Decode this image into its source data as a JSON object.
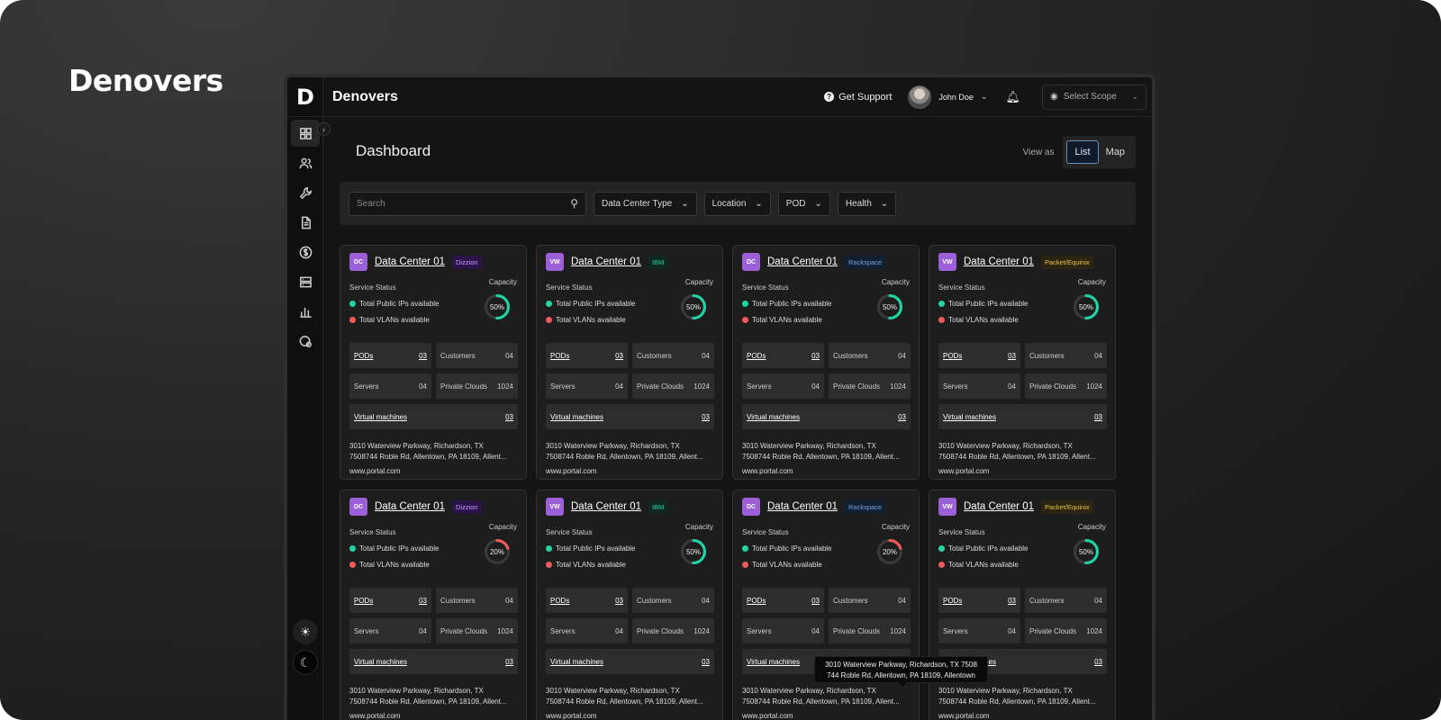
{
  "brand": "Denovers",
  "rail": {
    "logo": "D",
    "icons": [
      "dashboard-icon",
      "users-icon",
      "wrench-icon",
      "document-icon",
      "dollar-icon",
      "server-icon",
      "bar-chart-icon",
      "settings-shield-icon"
    ],
    "active_index": 0,
    "theme_light_icon": "sun-icon",
    "theme_dark_icon": "moon-icon"
  },
  "topbar": {
    "title": "Denovers",
    "support_label": "Get Support",
    "user_name": "John Doe",
    "scope_placeholder": "Select Scope"
  },
  "dashboard": {
    "title": "Dashboard",
    "view_as_label": "View as",
    "view_options": [
      "List",
      "Map"
    ],
    "active_view": "List"
  },
  "filters": {
    "search_placeholder": "Search",
    "dropdowns": [
      "Data Center Type",
      "Location",
      "POD",
      "Health"
    ]
  },
  "card_labels": {
    "service_status": "Service Status",
    "capacity": "Capacity",
    "public_ips": "Total Public IPs available",
    "vlans": "Total VLANs available",
    "pods": "PODs",
    "customers": "Customers",
    "servers": "Servers",
    "private_clouds": "Private Clouds",
    "virtual_machines": "Virtual machines"
  },
  "colors": {
    "green": "#22d3a6",
    "red": "#ef5b5b",
    "badge_purple": "#9b5fd8"
  },
  "cards": [
    {
      "badge": "DC",
      "title": "Data Center 01",
      "provider": "Dizzion",
      "provider_bg": "#2a1448",
      "provider_fg": "#c79bff",
      "capacity": 50,
      "capacity_text": "50%",
      "pods": "03",
      "customers": "04",
      "servers": "04",
      "private_clouds": "1024",
      "virtual_machines": "03",
      "address_1": "3010 Waterview Parkway, Richardson, TX",
      "address_2": "7508744 Roble Rd, Allentown, PA 18109, Allent...",
      "url": "www.portal.com"
    },
    {
      "badge": "VW",
      "title": "Data Center 01",
      "provider": "IBM",
      "provider_bg": "#10281f",
      "provider_fg": "#22d3a6",
      "capacity": 50,
      "capacity_text": "50%",
      "pods": "03",
      "customers": "04",
      "servers": "04",
      "private_clouds": "1024",
      "virtual_machines": "03",
      "address_1": "3010 Waterview Parkway, Richardson, TX",
      "address_2": "7508744 Roble Rd, Allentown, PA 18109, Allent...",
      "url": "www.portal.com"
    },
    {
      "badge": "DC",
      "title": "Data Center 01",
      "provider": "Rackspace",
      "provider_bg": "#122033",
      "provider_fg": "#7aa3d9",
      "capacity": 50,
      "capacity_text": "50%",
      "pods": "03",
      "customers": "04",
      "servers": "04",
      "private_clouds": "1024",
      "virtual_machines": "03",
      "address_1": "3010 Waterview Parkway, Richardson, TX",
      "address_2": "7508744 Roble Rd, Allentown, PA 18109, Allent...",
      "url": "www.portal.com"
    },
    {
      "badge": "VW",
      "title": "Data Center 01",
      "provider": "Packet/Equinix",
      "provider_bg": "#2a2410",
      "provider_fg": "#e8c64a",
      "capacity": 50,
      "capacity_text": "50%",
      "pods": "03",
      "customers": "04",
      "servers": "04",
      "private_clouds": "1024",
      "virtual_machines": "03",
      "address_1": "3010 Waterview Parkway, Richardson, TX",
      "address_2": "7508744 Roble Rd, Allentown, PA 18109, Allent...",
      "url": "www.portal.com"
    },
    {
      "badge": "DC",
      "title": "Data Center 01",
      "provider": "Dizzion",
      "provider_bg": "#2a1448",
      "provider_fg": "#c79bff",
      "capacity": 20,
      "capacity_text": "20%",
      "pods": "03",
      "customers": "04",
      "servers": "04",
      "private_clouds": "1024",
      "virtual_machines": "03",
      "address_1": "3010 Waterview Parkway, Richardson, TX",
      "address_2": "7508744 Roble Rd, Allentown, PA 18109, Allent...",
      "url": "www.portal.com"
    },
    {
      "badge": "VW",
      "title": "Data Center 01",
      "provider": "IBM",
      "provider_bg": "#10281f",
      "provider_fg": "#22d3a6",
      "capacity": 50,
      "capacity_text": "50%",
      "pods": "03",
      "customers": "04",
      "servers": "04",
      "private_clouds": "1024",
      "virtual_machines": "03",
      "address_1": "3010 Waterview Parkway, Richardson, TX",
      "address_2": "7508744 Roble Rd, Allentown, PA 18109, Allent...",
      "url": "www.portal.com"
    },
    {
      "badge": "DC",
      "title": "Data Center 01",
      "provider": "Rackspace",
      "provider_bg": "#122033",
      "provider_fg": "#7aa3d9",
      "capacity": 20,
      "capacity_text": "20%",
      "pods": "03",
      "customers": "04",
      "servers": "04",
      "private_clouds": "1024",
      "virtual_machines": "03",
      "address_1": "3010 Waterview Parkway, Richardson, TX",
      "address_2": "7508744 Roble Rd, Allentown, PA 18109, Allent...",
      "url": "www.portal.com"
    },
    {
      "badge": "VW",
      "title": "Data Center 01",
      "provider": "Packet/Equinix",
      "provider_bg": "#2a2410",
      "provider_fg": "#e8c64a",
      "capacity": 50,
      "capacity_text": "50%",
      "pods": "03",
      "customers": "04",
      "servers": "04",
      "private_clouds": "1024",
      "virtual_machines": "03",
      "address_1": "3010 Waterview Parkway, Richardson, TX",
      "address_2": "7508744 Roble Rd, Allentown, PA 18109, Allent...",
      "url": "www.portal.com"
    }
  ],
  "tooltip": {
    "line_1": "3010 Waterview Parkway, Richardson, TX 7508",
    "line_2": "744 Roble Rd, Allentown, PA 18109, Allentown"
  }
}
